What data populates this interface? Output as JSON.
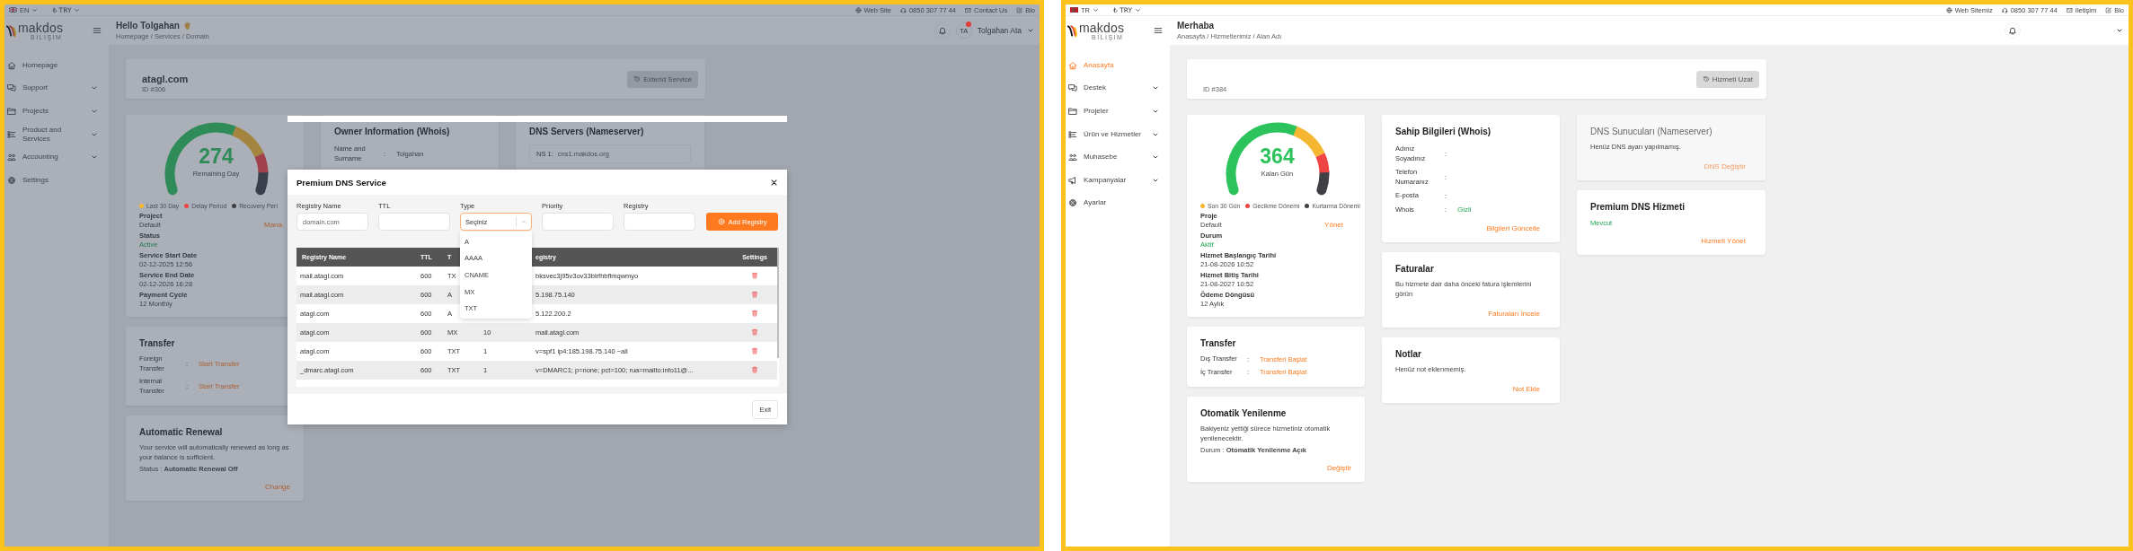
{
  "panels": [
    {
      "top_bar": {
        "language": {
          "label": "EN",
          "kind": "english"
        },
        "currency": "₺ TRY",
        "links": [
          "Web Site",
          "0850 307 77 44",
          "Contact Us",
          "Blo"
        ]
      },
      "header": {
        "logo": {
          "name": "makdos",
          "tagline": "BİLİŞİM"
        },
        "greeting": "Hello Tolgahan",
        "wave": true,
        "breadcrumb": "Homepage / Services / Domain",
        "user": {
          "initials": "TA",
          "name": "Tolgahan Ata",
          "unread": true
        }
      },
      "sidebar": {
        "items": [
          {
            "label": "Homepage",
            "submenu": false,
            "selected": false
          },
          {
            "label": "Support",
            "submenu": true,
            "selected": false
          },
          {
            "label": "Projects",
            "submenu": true,
            "selected": false
          },
          {
            "label": "Product and Services",
            "submenu": true,
            "selected": false
          },
          {
            "label": "Accounting",
            "submenu": true,
            "selected": false
          },
          {
            "label": "Settings",
            "submenu": false,
            "selected": false
          }
        ]
      },
      "domain_card": {
        "title": "atagl.com",
        "id": "ID #306",
        "button": "Extend Service",
        "disabled": true
      },
      "columns": [
        [
          {
            "kind": "gauge",
            "value": "274",
            "caption": "Remaining Day",
            "legend": [
              {
                "label": "Last 30 Day",
                "color": "#f5b731"
              },
              {
                "label": "Delay Period",
                "color": "#ef4444"
              },
              {
                "label": "Recovery Peri",
                "color": "#3f3f46"
              }
            ],
            "fields": [
              {
                "label": "Project",
                "value": "Default",
                "link": "Mana",
                "kind": "text"
              },
              {
                "label": "Status",
                "value": "Active",
                "kind": "status"
              },
              {
                "label": "Service Start Date",
                "value": "02-12-2025 12:56",
                "kind": "text"
              },
              {
                "label": "Service End Date",
                "value": "02-12-2026 16:28",
                "kind": "text"
              },
              {
                "label": "Payment Cycle",
                "value": "12 Monthly",
                "kind": "text"
              }
            ]
          },
          {
            "kind": "transfer",
            "title": "Transfer",
            "rows": [
              {
                "label": "Foreign Transfer",
                "sep": ":",
                "link": "Start Transfer"
              },
              {
                "label": "Internal Transfer",
                "sep": ":",
                "link": "Start Transfer"
              }
            ]
          },
          {
            "kind": "renewal",
            "title": "Automatic Renewal",
            "text": "Your service will automatically renewed as long as your balance is sufficient.",
            "status": "Status : **Automatic Renewal Off**",
            "link": "Change"
          }
        ],
        [
          {
            "kind": "owner",
            "title": "Owner Information (Whois)",
            "rows": [
              {
                "label": "Name and Surname",
                "sep": ":",
                "value": "Tolgahan",
                "kind": "text"
              }
            ]
          }
        ],
        [
          {
            "kind": "dns",
            "title": "DNS Servers (Nameserver)",
            "servers": [
              {
                "label": "NS 1:",
                "value": "cns1.makdos.org"
              }
            ],
            "disabled": false
          }
        ]
      ],
      "modal": {
        "title": "Premium DNS Service",
        "fields": [
          {
            "label": "Registry Name",
            "kind": "input",
            "placeholder": "domain.com"
          },
          {
            "label": "TTL",
            "kind": "input"
          },
          {
            "label": "Type",
            "kind": "select",
            "value": "Seçiniz",
            "expanded": true,
            "options": [
              "A",
              "AAAA",
              "CNAME",
              "MX",
              "TXT"
            ]
          },
          {
            "label": "Priority",
            "kind": "input"
          },
          {
            "label": "Registry",
            "kind": "input"
          }
        ],
        "button": "Add Registry",
        "columns": {
          "name": "Registry Name",
          "ttl": "TTL",
          "type": "T",
          "registry": "egistry",
          "settings": "Settings"
        },
        "rows": [
          {
            "name": "mail.atagl.com",
            "ttl": "600",
            "type": "TX",
            "registry": "bksvec3j95v3ov33blrfhbflmqwmyo"
          },
          {
            "name": "mail.atagl.com",
            "ttl": "600",
            "type": "A",
            "registry": "5.198.75.140"
          },
          {
            "name": "atagl.com",
            "ttl": "600",
            "type": "A",
            "registry": "5.122.200.2"
          },
          {
            "name": "atagl.com",
            "ttl": "600",
            "type": "MX",
            "priority": "10",
            "registry": "mail.atagl.com"
          },
          {
            "name": "atagl.com",
            "ttl": "600",
            "type": "TXT",
            "priority": "1",
            "registry": "v=spf1 ip4:185.198.75.140 ~all"
          },
          {
            "name": "_dmarc.atagl.com",
            "ttl": "600",
            "type": "TXT",
            "priority": "1",
            "registry": "v=DMARC1; p=none; pct=100; rua=mailto:info11@..."
          }
        ],
        "exit_button": "Exit"
      }
    },
    {
      "top_bar": {
        "language": {
          "label": "TR",
          "kind": "turkish"
        },
        "currency": "₺ TRY",
        "links": [
          "Web Sitemiz",
          "0850 307 77 44",
          "İletişim",
          "Blo"
        ]
      },
      "header": {
        "logo": {
          "name": "makdos",
          "tagline": "BİLİŞİM"
        },
        "greeting": "Merhaba",
        "wave": false,
        "breadcrumb": "Anasayfa / Hizmetlerimiz / Alan Adı"
      },
      "sidebar": {
        "items": [
          {
            "label": "Anasayfa",
            "submenu": false,
            "selected": true
          },
          {
            "label": "Destek",
            "submenu": true,
            "selected": false
          },
          {
            "label": "Projeler",
            "submenu": true,
            "selected": false
          },
          {
            "label": "Ürün ve Hizmetler",
            "submenu": true,
            "selected": false
          },
          {
            "label": "Muhasebe",
            "submenu": true,
            "selected": false
          },
          {
            "label": "Kampanyalar",
            "submenu": true,
            "selected": false
          },
          {
            "label": "Ayarlar",
            "submenu": false,
            "selected": false
          }
        ]
      },
      "domain_card": {
        "id": "ID #384",
        "button": "Hizmeti Uzat",
        "disabled": true
      },
      "columns": [
        [
          {
            "kind": "gauge",
            "value": "364",
            "caption": "Kalan Gün",
            "legend": [
              {
                "label": "Son 30 Gün",
                "color": "#f5b731"
              },
              {
                "label": "Gecikme Dönemi",
                "color": "#ef4444"
              },
              {
                "label": "Kurtarma Dönemi",
                "color": "#3f3f46"
              }
            ],
            "fields": [
              {
                "label": "Proje",
                "value": "Default",
                "link": "Yönet",
                "kind": "text"
              },
              {
                "label": "Durum",
                "value": "Aktif",
                "kind": "status"
              },
              {
                "label": "Hizmet Başlangıç Tarihi",
                "value": "21-08-2026 10:52",
                "kind": "text"
              },
              {
                "label": "Hizmet Bitiş Tarihi",
                "value": "21-08-2027 10:52",
                "kind": "text"
              },
              {
                "label": "Ödeme Döngüsü",
                "value": "12 Aylık",
                "kind": "text"
              }
            ]
          },
          {
            "kind": "transfer",
            "title": "Transfer",
            "rows": [
              {
                "label": "Dış Transfer",
                "sep": ":",
                "link": "Transferi Başlat"
              },
              {
                "label": "İç Transfer",
                "sep": ":",
                "link": "Transferi Başlat"
              }
            ]
          },
          {
            "kind": "renewal",
            "title": "Otomatik Yenilenme",
            "text": "Bakiyeniz yettiği sürece hizmetiniz otomatik yenilenecektir.",
            "status": "Durum : **Otomatik Yenilenme Açık**",
            "link": "Değiştir"
          }
        ],
        [
          {
            "kind": "owner",
            "title": "Sahip Bilgileri (Whois)",
            "rows": [
              {
                "label": "Adınız Soyadınız",
                "sep": ":",
                "kind": "text"
              },
              {
                "label": "Telefon Numaranız",
                "sep": ":",
                "kind": "text"
              },
              {
                "label": "E-posta",
                "sep": ":",
                "kind": "text"
              },
              {
                "label": "Whois",
                "sep": ":",
                "value": "Gizli",
                "kind": "status"
              }
            ],
            "link": "Bilgileri Güncelle"
          },
          {
            "kind": "note",
            "title": "Faturalar",
            "text": "Bu hizmete dair daha önceki fatura işlemlerini görün",
            "link": "Faturaları İncele"
          },
          {
            "kind": "note",
            "title": "Notlar",
            "text": "Henüz not eklenmemiş.",
            "link": "Not Ekle"
          }
        ],
        [
          {
            "kind": "dns",
            "title": "DNS Sunucuları (Nameserver)",
            "text": "Henüz DNS ayarı yapılmamış.",
            "link": "DNS Değiştir",
            "disabled": true
          },
          {
            "kind": "service",
            "title": "Premium DNS Hizmeti",
            "state": "Mevcut",
            "link": "Hizmeti Yönet"
          }
        ]
      ]
    }
  ]
}
